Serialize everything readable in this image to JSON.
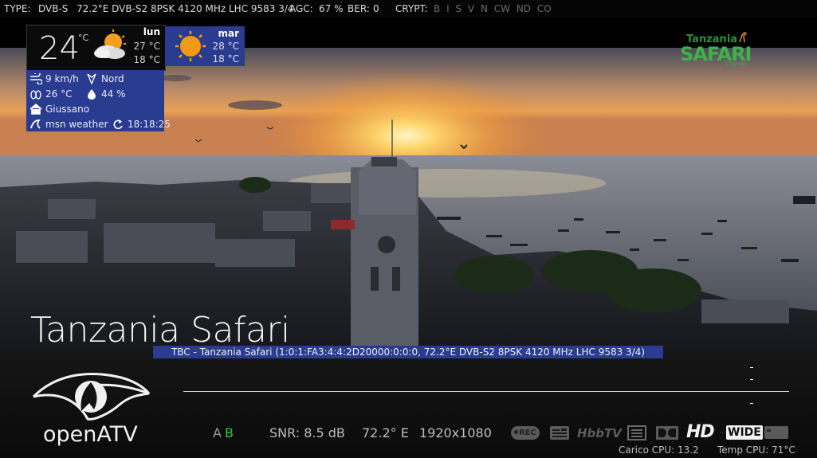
{
  "top_bar": {
    "type_label": "TYPE:",
    "type_value": "DVB-S",
    "tuner_info": "72.2°E DVB-S2 8PSK 4120 MHz LHC 9583 3/4",
    "agc_label": "AGC:",
    "agc_value": "67 %",
    "ber_label": "BER:",
    "ber_value": "0",
    "crypt_label": "CRYPT:",
    "crypt_systems": [
      "B",
      "I",
      "S",
      "V",
      "N",
      "CW",
      "ND",
      "CO"
    ]
  },
  "weather": {
    "current_temp": "24",
    "unit": "°C",
    "today": {
      "day": "lun",
      "high": "27 °C",
      "low": "18 °C"
    },
    "tomorrow": {
      "day": "mar",
      "high": "28 °C",
      "low": "18 °C"
    },
    "wind_speed": "9 km/h",
    "wind_dir": "Nord",
    "feels_like": "26 °C",
    "humidity": "44 %",
    "location": "Giussano",
    "source": "msn weather",
    "updated": "18:18:25"
  },
  "channel": {
    "name": "Tanzania Safari",
    "logo_line1": "Tanzania",
    "logo_line2": "SAFARI",
    "logo_line3": "Channel",
    "service_info": "TBC - Tanzania Safari (1:0:1:FA3:4:4:2D20000:0:0:0, 72.2°E DVB-S2 8PSK 4120 MHz LHC 9583 3/4)"
  },
  "status": {
    "brand": "openATV",
    "stream_a": "A",
    "stream_b": "B",
    "snr": "SNR: 8.5 dB",
    "orbital": "72.2° E",
    "resolution": "1920x1080",
    "rec_label": "REC",
    "hbbtv_label": "HbbTV",
    "hd_label": "HD",
    "wide_label": "WIDE",
    "cpu_load": "Carico CPU: 13.2",
    "cpu_temp": "Temp CPU: 71°C"
  },
  "colors": {
    "panel_blue": "#2a3c8f",
    "stream_active": "#2ecc40",
    "sun": "#f39a14"
  }
}
